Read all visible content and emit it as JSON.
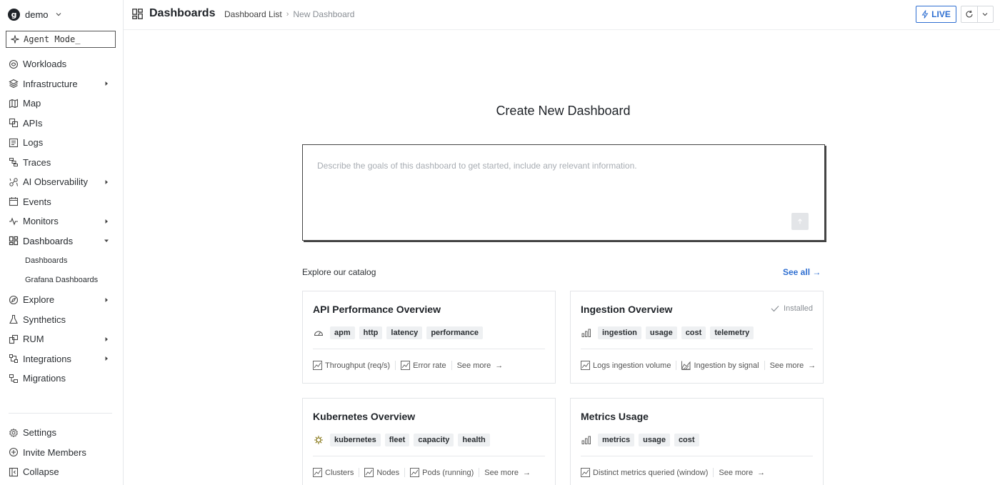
{
  "org": {
    "initial": "g",
    "name": "demo"
  },
  "agent_mode": {
    "label": "Agent Mode_"
  },
  "nav": {
    "items": [
      {
        "label": "Workloads",
        "icon": "workloads-icon",
        "caret": false
      },
      {
        "label": "Infrastructure",
        "icon": "layers-icon",
        "caret": true
      },
      {
        "label": "Map",
        "icon": "map-icon",
        "caret": false
      },
      {
        "label": "APIs",
        "icon": "apis-icon",
        "caret": false
      },
      {
        "label": "Logs",
        "icon": "logs-icon",
        "caret": false
      },
      {
        "label": "Traces",
        "icon": "traces-icon",
        "caret": false
      },
      {
        "label": "AI Observability",
        "icon": "ai-observability-icon",
        "caret": true
      },
      {
        "label": "Events",
        "icon": "calendar-icon",
        "caret": false
      },
      {
        "label": "Monitors",
        "icon": "pulse-icon",
        "caret": true
      },
      {
        "label": "Dashboards",
        "icon": "dashboard-icon",
        "caret": "open"
      }
    ],
    "dashboards_sub": [
      "Dashboards",
      "Grafana Dashboards"
    ],
    "items_after": [
      {
        "label": "Explore",
        "icon": "explore-icon",
        "caret": true
      },
      {
        "label": "Synthetics",
        "icon": "flask-icon",
        "caret": false
      },
      {
        "label": "RUM",
        "icon": "rum-icon",
        "caret": true
      },
      {
        "label": "Integrations",
        "icon": "integrations-icon",
        "caret": true
      },
      {
        "label": "Migrations",
        "icon": "migrations-icon",
        "caret": false
      }
    ],
    "bottom": [
      {
        "label": "Settings",
        "icon": "gear-icon"
      },
      {
        "label": "Invite Members",
        "icon": "plus-circle-icon"
      },
      {
        "label": "Collapse",
        "icon": "collapse-icon"
      }
    ]
  },
  "header": {
    "title": "Dashboards",
    "breadcrumb": [
      "Dashboard List",
      "New Dashboard"
    ],
    "live_label": "LIVE"
  },
  "main": {
    "title": "Create New Dashboard",
    "prompt_placeholder": "Describe the goals of this dashboard to get started, include any relevant information.",
    "catalog_label": "Explore our catalog",
    "see_all": "See all →"
  },
  "cards": [
    {
      "title": "API Performance Overview",
      "installed": "",
      "tag_icon": "gauge-icon",
      "tags": [
        "apm",
        "http",
        "latency",
        "performance"
      ],
      "metrics": [
        "Throughput (req/s)",
        "Error rate"
      ],
      "see_more": "See more"
    },
    {
      "title": "Ingestion Overview",
      "installed": "Installed",
      "tag_icon": "bars-icon",
      "tags": [
        "ingestion",
        "usage",
        "cost",
        "telemetry"
      ],
      "metrics": [
        "Logs ingestion volume",
        "Ingestion by signal"
      ],
      "see_more": "See more"
    },
    {
      "title": "Kubernetes Overview",
      "installed": "",
      "tag_icon": "kubernetes-icon",
      "tags": [
        "kubernetes",
        "fleet",
        "capacity",
        "health"
      ],
      "metrics": [
        "Clusters",
        "Nodes",
        "Pods (running)"
      ],
      "see_more": "See more"
    },
    {
      "title": "Metrics Usage",
      "installed": "",
      "tag_icon": "bars-icon",
      "tags": [
        "metrics",
        "usage",
        "cost"
      ],
      "metrics": [
        "Distinct metrics queried (window)"
      ],
      "see_more": "See more"
    }
  ],
  "colors": {
    "accent": "#2f6fd1",
    "text": "#1f2328",
    "border": "#e3e5e8"
  }
}
